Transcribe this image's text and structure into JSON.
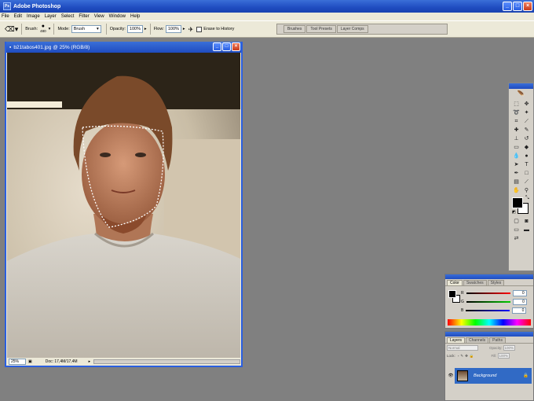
{
  "app": {
    "title": "Adobe Photoshop"
  },
  "menu": [
    "File",
    "Edit",
    "Image",
    "Layer",
    "Select",
    "Filter",
    "View",
    "Window",
    "Help"
  ],
  "options": {
    "brush_label": "Brush:",
    "brush_size": "480",
    "mode_label": "Mode:",
    "mode_value": "Brush",
    "opacity_label": "Opacity:",
    "opacity_value": "100%",
    "flow_label": "Flow:",
    "flow_value": "100%",
    "erase_history_label": "Erase to History"
  },
  "palette_well_tabs": [
    "Brushes",
    "Tool Presets",
    "Layer Comps"
  ],
  "document": {
    "title": "b21tabos401.jpg @ 25% (RGB/8)",
    "zoom": "25%",
    "doc_size": "Doc: 17,4M/17,4M"
  },
  "color_palette": {
    "tabs": [
      "Color",
      "Swatches",
      "Styles"
    ],
    "r_label": "R",
    "g_label": "G",
    "b_label": "B",
    "r_value": "0",
    "g_value": "0",
    "b_value": "0"
  },
  "layers_palette": {
    "tabs": [
      "Layers",
      "Channels",
      "Paths"
    ],
    "blend_mode": "Normal",
    "opacity_label": "Opacity:",
    "opacity_value": "100%",
    "lock_label": "Lock:",
    "fill_label": "Fill:",
    "fill_value": "100%",
    "layer_name": "Background"
  },
  "colors": {
    "accent": "#316ac5",
    "workspace": "#808080"
  }
}
